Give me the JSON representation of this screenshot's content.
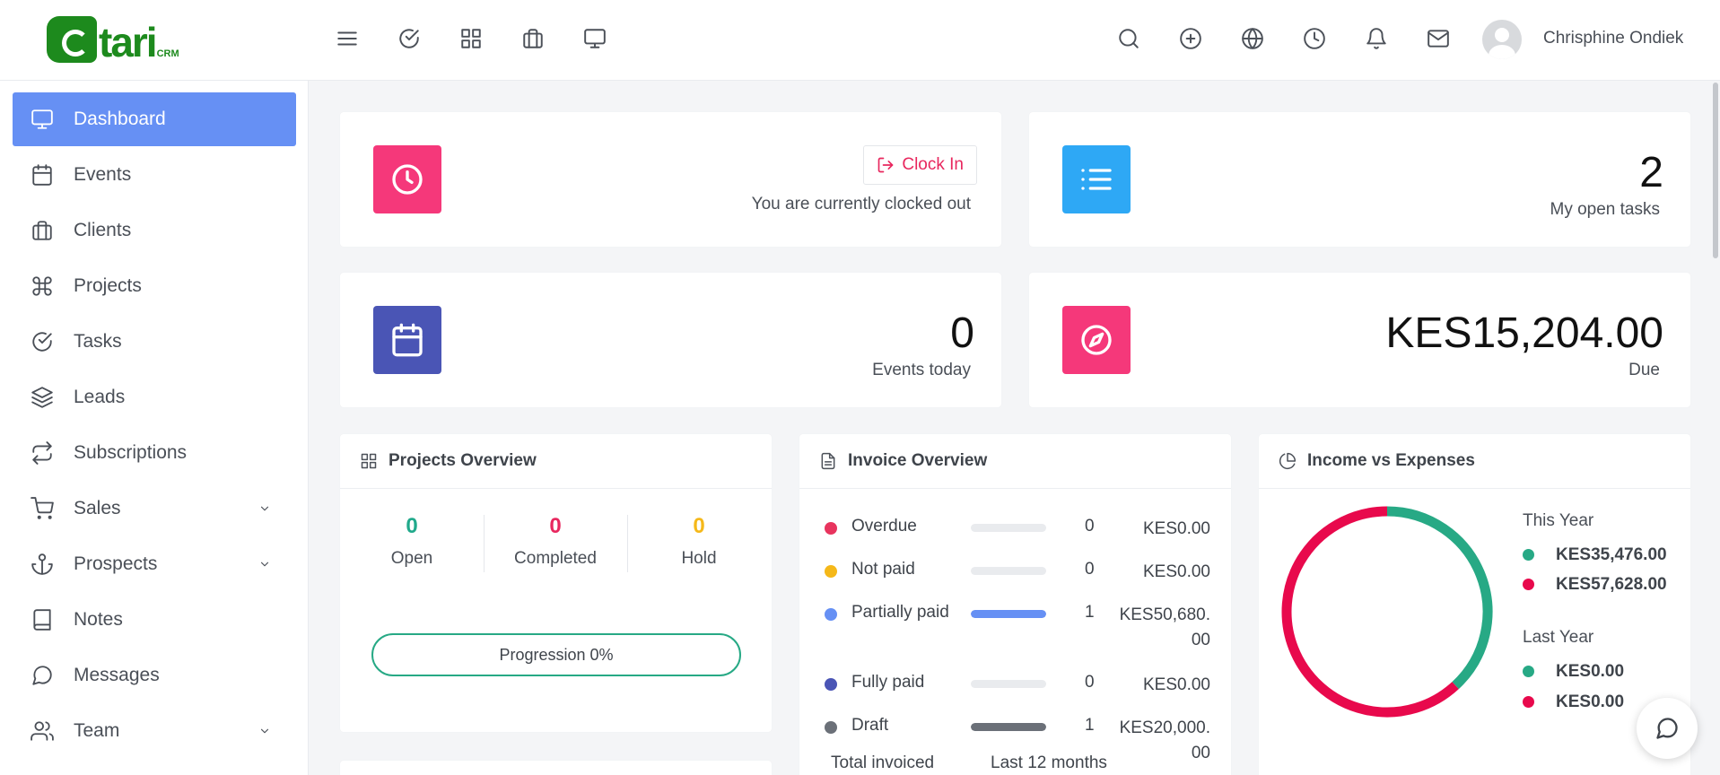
{
  "header": {
    "logo_text": "tari",
    "logo_sub": "CRM",
    "user_name": "Chrisphine Ondiek",
    "left_icons": [
      "menu-icon",
      "check-circle-icon",
      "grid-icon",
      "briefcase-icon",
      "monitor-icon"
    ],
    "right_icons": [
      "search-icon",
      "plus-circle-icon",
      "globe-icon",
      "clock-icon",
      "bell-icon",
      "mail-icon"
    ]
  },
  "sidebar": {
    "items": [
      {
        "label": "Dashboard",
        "icon": "monitor-icon",
        "active": true
      },
      {
        "label": "Events",
        "icon": "calendar-icon"
      },
      {
        "label": "Clients",
        "icon": "briefcase-icon"
      },
      {
        "label": "Projects",
        "icon": "command-icon"
      },
      {
        "label": "Tasks",
        "icon": "check-circle-icon"
      },
      {
        "label": "Leads",
        "icon": "layers-icon"
      },
      {
        "label": "Subscriptions",
        "icon": "repeat-icon"
      },
      {
        "label": "Sales",
        "icon": "cart-icon",
        "has_submenu": true
      },
      {
        "label": "Prospects",
        "icon": "anchor-icon",
        "has_submenu": true
      },
      {
        "label": "Notes",
        "icon": "book-icon"
      },
      {
        "label": "Messages",
        "icon": "message-icon"
      },
      {
        "label": "Team",
        "icon": "users-icon",
        "has_submenu": true
      }
    ]
  },
  "widgets": {
    "clock": {
      "button_label": "Clock In",
      "status": "You are currently clocked out",
      "color": "#f5387a"
    },
    "open_tasks": {
      "value": "2",
      "label": "My open tasks",
      "color": "#2ea8f5"
    },
    "events_today": {
      "value": "0",
      "label": "Events today",
      "color": "#4a55b5"
    },
    "due": {
      "value": "KES15,204.00",
      "label": "Due",
      "color": "#f5387a"
    }
  },
  "projects_overview": {
    "title": "Projects Overview",
    "stats": [
      {
        "value": "0",
        "label": "Open",
        "color": "#20a98b"
      },
      {
        "value": "0",
        "label": "Completed",
        "color": "#e8275e"
      },
      {
        "value": "0",
        "label": "Hold",
        "color": "#f5b819"
      }
    ],
    "progress_label": "Progression 0%",
    "progress": 0
  },
  "invoice_overview": {
    "title": "Invoice Overview",
    "rows": [
      {
        "label": "Overdue",
        "count": "0",
        "amount": "KES0.00",
        "color": "#e8345e",
        "fill": 0
      },
      {
        "label": "Not paid",
        "count": "0",
        "amount": "KES0.00",
        "color": "#f5b819",
        "fill": 0
      },
      {
        "label": "Partially paid",
        "count": "1",
        "amount": "KES50,680.00",
        "color": "#6690f4",
        "fill": 1
      },
      {
        "label": "Fully paid",
        "count": "0",
        "amount": "KES0.00",
        "color": "#4a55b5",
        "fill": 0
      },
      {
        "label": "Draft",
        "count": "1",
        "amount": "KES20,000.00",
        "color": "#6b7078",
        "fill": 1
      }
    ],
    "footer_left": "Total invoiced",
    "footer_right": "Last 12 months"
  },
  "income_expenses": {
    "title": "Income vs Expenses",
    "this_year_label": "This Year",
    "this_year": [
      {
        "amount": "KES35,476.00",
        "color": "#27a985"
      },
      {
        "amount": "KES57,628.00",
        "color": "#e8094c"
      }
    ],
    "last_year_label": "Last Year",
    "last_year": [
      {
        "amount": "KES0.00",
        "color": "#27a985"
      },
      {
        "amount": "KES0.00",
        "color": "#e8094c"
      }
    ]
  },
  "chart_data": {
    "type": "pie",
    "categories": [
      "Income",
      "Expenses"
    ],
    "values": [
      35476,
      57628
    ]
  }
}
